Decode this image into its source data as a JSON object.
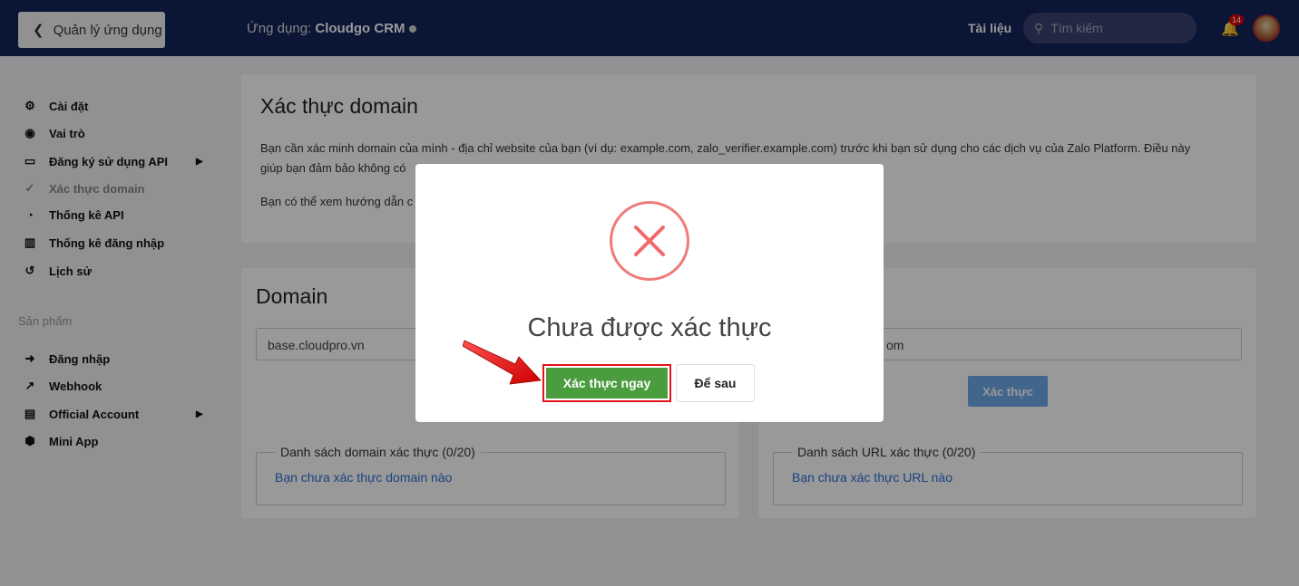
{
  "header": {
    "back_label": "Quản lý ứng dụng",
    "app_prefix": "Ứng dụng:",
    "app_name": "Cloudgo CRM",
    "docs": "Tài liệu",
    "search_placeholder": "Tìm kiếm",
    "notification_count": "14"
  },
  "sidebar": {
    "items": [
      {
        "label": "Cài đặt",
        "icon": "⚙"
      },
      {
        "label": "Vai trò",
        "icon": "◉"
      },
      {
        "label": "Đăng ký sử dụng API",
        "icon": "▭",
        "submenu": true
      },
      {
        "label": "Xác thực domain",
        "icon": "✓",
        "active": true
      },
      {
        "label": "Thống kê API",
        "icon": "◔"
      },
      {
        "label": "Thống kê đăng nhập",
        "icon": "▥"
      },
      {
        "label": "Lịch sử",
        "icon": "↺"
      }
    ],
    "section": "Sản phẩm",
    "products": [
      {
        "label": "Đăng nhập",
        "icon": "➜"
      },
      {
        "label": "Webhook",
        "icon": "↗"
      },
      {
        "label": "Official Account",
        "icon": "▤",
        "submenu": true
      },
      {
        "label": "Mini App",
        "icon": "⬢"
      }
    ]
  },
  "intro": {
    "title": "Xác thực domain",
    "para1_line1": "Bạn cần xác minh domain của mình - địa chỉ website của bạn (ví dụ: example.com, zalo_verifier.example.com) trước khi bạn sử dụng cho các dịch vụ của Zalo Platform. Điều này",
    "para1_line2": "giúp bạn đảm bảo không có",
    "para2": "Bạn có thể xem hướng dẫn c"
  },
  "domain_card": {
    "title": "Domain",
    "input_value": "base.cloudpro.vn",
    "list_legend": "Danh sách domain xác thực (0/20)",
    "empty_text": "Bạn chưa xác thực domain nào"
  },
  "url_card": {
    "input_value": "om",
    "verify_label": "Xác thực",
    "list_legend": "Danh sách URL xác thực (0/20)",
    "empty_text": "Bạn chưa xác thực URL nào"
  },
  "modal": {
    "title": "Chưa được xác thực",
    "primary_label": "Xác thực ngay",
    "secondary_label": "Để sau",
    "error_color": "#ef7b7b"
  }
}
